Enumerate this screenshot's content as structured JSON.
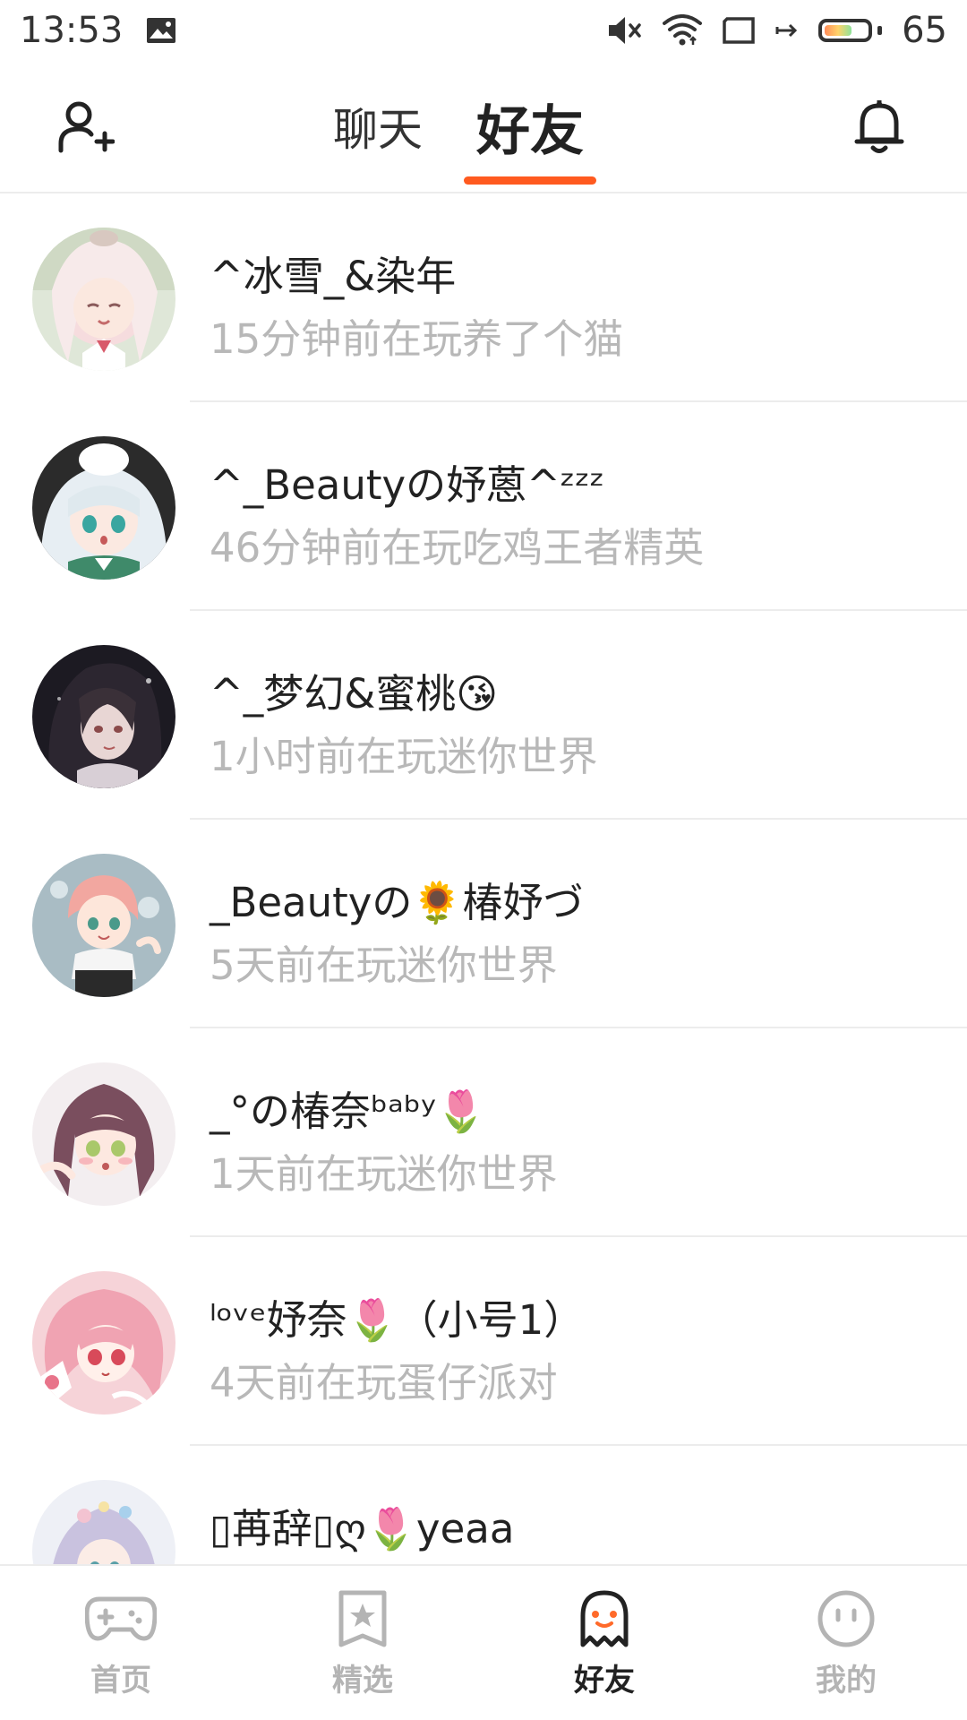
{
  "status_bar": {
    "time": "13:53",
    "battery_level": "65",
    "battery_fraction": 0.65
  },
  "top_nav": {
    "tabs": [
      {
        "label": "聊天",
        "active": false
      },
      {
        "label": "好友",
        "active": true
      }
    ],
    "accent_color": "#ff5a1f"
  },
  "friends": [
    {
      "name": "^冰雪_&染年",
      "status": "15分钟前在玩养了个猫"
    },
    {
      "name": "^_Beautyの妤蒽^ᶻᶻᶻ",
      "status": "46分钟前在玩吃鸡王者精英"
    },
    {
      "name": "^_梦幻&蜜桃😘",
      "status": "1小时前在玩迷你世界"
    },
    {
      "name": "_Beautyの🌻椿妤づ",
      "status": "5天前在玩迷你世界"
    },
    {
      "name": "_°の椿奈ᵇᵃᵇʸ🌷",
      "status": "1天前在玩迷你世界"
    },
    {
      "name": "ˡᵒᵛᵉ妤奈🌷（小号1）",
      "status": "4天前在玩蛋仔派对"
    },
    {
      "name": "▯苒辞▯ღ🌷yeaa",
      "status": ""
    }
  ],
  "bottom_nav": {
    "items": [
      {
        "label": "首页",
        "icon": "gamepad-icon",
        "active": false
      },
      {
        "label": "精选",
        "icon": "star-bookmark-icon",
        "active": false
      },
      {
        "label": "好友",
        "icon": "ghost-icon",
        "active": true
      },
      {
        "label": "我的",
        "icon": "face-icon",
        "active": false
      }
    ]
  }
}
